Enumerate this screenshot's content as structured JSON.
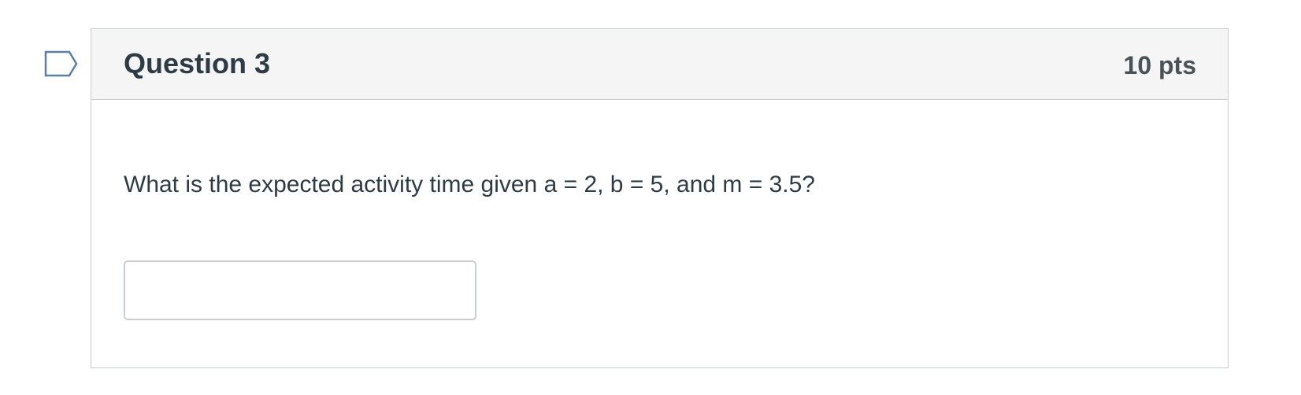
{
  "flag": {
    "icon": "flag-bookmark-icon",
    "color": "#5b7fa6"
  },
  "question": {
    "title": "Question 3",
    "points": "10 pts",
    "text": "What is the expected activity time given a = 2, b = 5, and m = 3.5?",
    "answer_value": "",
    "answer_placeholder": ""
  },
  "colors": {
    "header_background": "#f5f5f5",
    "border": "#c7cdd1",
    "text": "#2d3b45"
  }
}
